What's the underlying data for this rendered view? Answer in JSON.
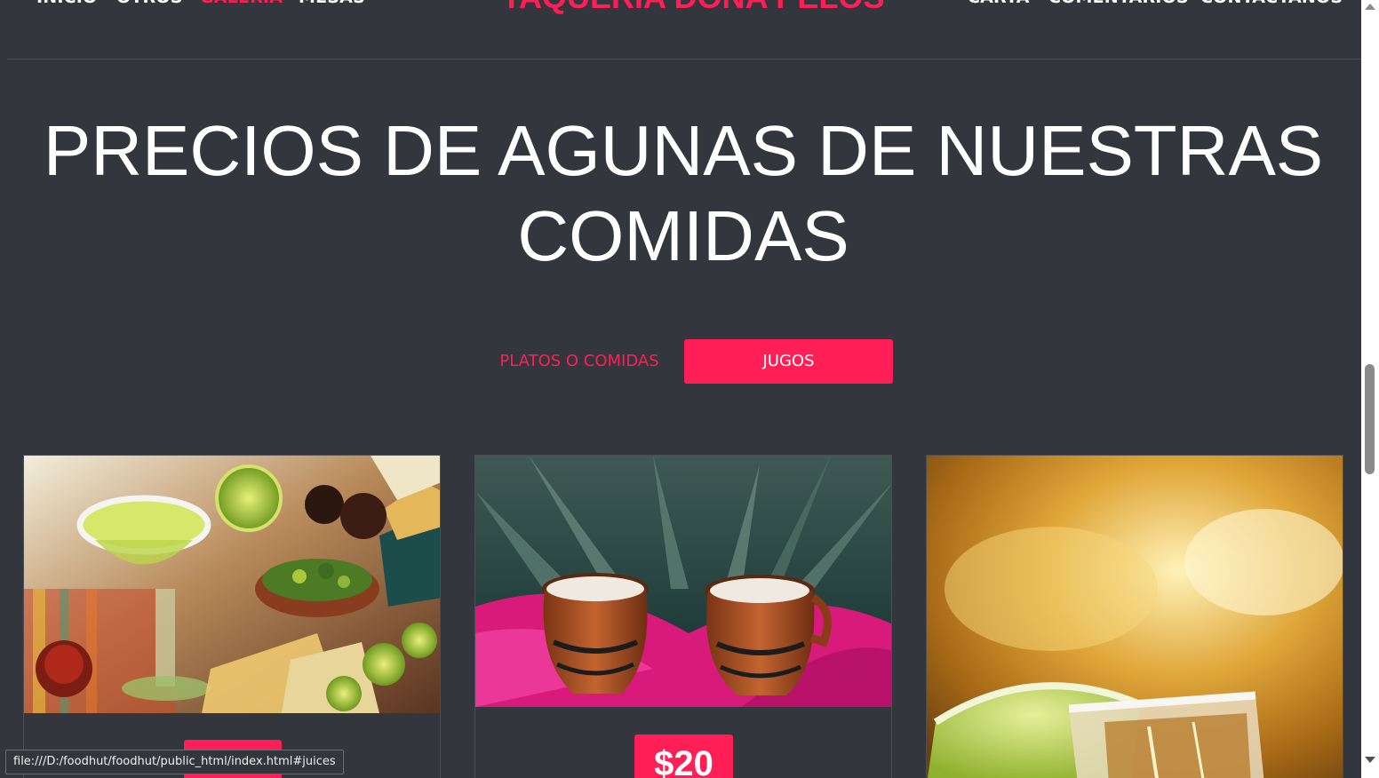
{
  "nav": {
    "left_links": [
      "INICIO",
      "OTROS",
      "GALERIA",
      "MESAS"
    ],
    "active_link": "GALERIA",
    "brand": "TAQUERIA DOÑA PELOS",
    "right_links": [
      "CARTA",
      "COMENTARIOS",
      "CONTACTANOS"
    ]
  },
  "section": {
    "title": "PRECIOS DE AGUNAS DE NUESTRAS COMIDAS"
  },
  "filter_tabs": {
    "platos_label": "PLATOS O COMIDAS",
    "jugos_label": "JUGOS",
    "active": "JUGOS"
  },
  "cards": [
    {
      "image": "margaritas-guacamole-photo",
      "price": ""
    },
    {
      "image": "pulque-clay-jars-photo",
      "price": "$20"
    },
    {
      "image": "tequila-shot-lime-photo",
      "price": ""
    }
  ],
  "status_bar": {
    "url": "file:///D:/foodhut/foodhut/public_html/index.html#juices"
  },
  "colors": {
    "accent": "#ff1f56",
    "background": "#33363c",
    "text": "#ffffff"
  }
}
